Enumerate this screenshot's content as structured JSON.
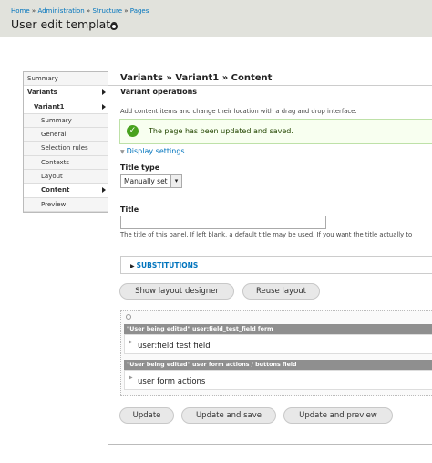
{
  "breadcrumb": {
    "home": "Home",
    "administration": "Administration",
    "structure": "Structure",
    "pages": "Pages",
    "separator": "»"
  },
  "page_title": "User edit template",
  "sidebar": {
    "items": [
      {
        "label": "Summary"
      },
      {
        "label": "Variants"
      },
      {
        "label": "Variant1"
      },
      {
        "label": "Summary"
      },
      {
        "label": "General"
      },
      {
        "label": "Selection rules"
      },
      {
        "label": "Contexts"
      },
      {
        "label": "Layout"
      },
      {
        "label": "Content"
      },
      {
        "label": "Preview"
      }
    ]
  },
  "main": {
    "title": "Variants » Variant1 » Content",
    "operations_title": "Variant operations",
    "description": "Add content items and change their location with a drag and drop interface.",
    "status_message": "The page has been updated and saved.",
    "display_settings": "Display settings",
    "title_type_label": "Title type",
    "title_type_value": "Manually set",
    "title_label": "Title",
    "title_value": "",
    "title_help": "The title of this panel. If left blank, a default title may be used. If you want the title actually to",
    "substitutions": "SUBSTITUTIONS",
    "show_layout_designer": "Show layout designer",
    "reuse_layout": "Reuse layout",
    "regions": [
      {
        "header": "\"User being edited\" user:field_test_field form",
        "item": "user:field test field"
      },
      {
        "header": "\"User being edited\" user form actions / buttons field",
        "item": "user form actions"
      }
    ],
    "update": "Update",
    "update_and_save": "Update and save",
    "update_and_preview": "Update and preview"
  }
}
